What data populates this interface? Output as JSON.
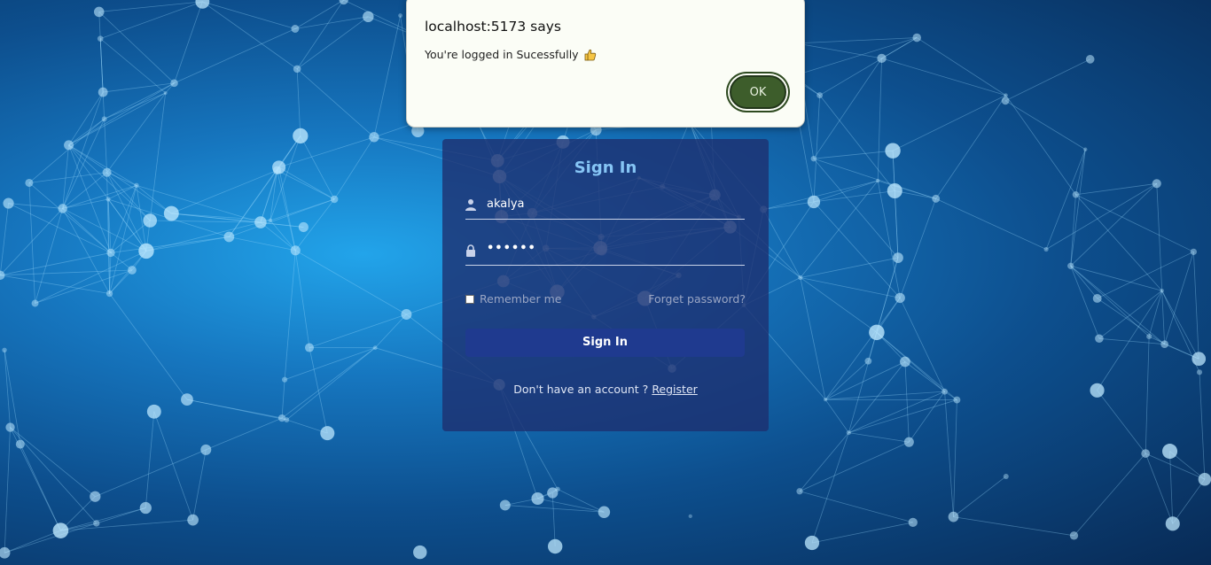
{
  "dialog": {
    "title": "localhost:5173 says",
    "message": "You're logged in Sucessfully",
    "emoji": "thumbs-up-icon",
    "ok_label": "OK"
  },
  "signin": {
    "title": "Sign In",
    "username_value": "akalya",
    "password_value": "••••••",
    "remember_label": "Remember me",
    "forgot_label": "Forget password?",
    "button_label": "Sign In",
    "no_account_text": "Don't have an account ?",
    "register_label": "Register"
  },
  "colors": {
    "accent_title": "#86c5f5",
    "button_bg": "#1f3a8f",
    "dialog_ok": "#3d5d2b"
  }
}
